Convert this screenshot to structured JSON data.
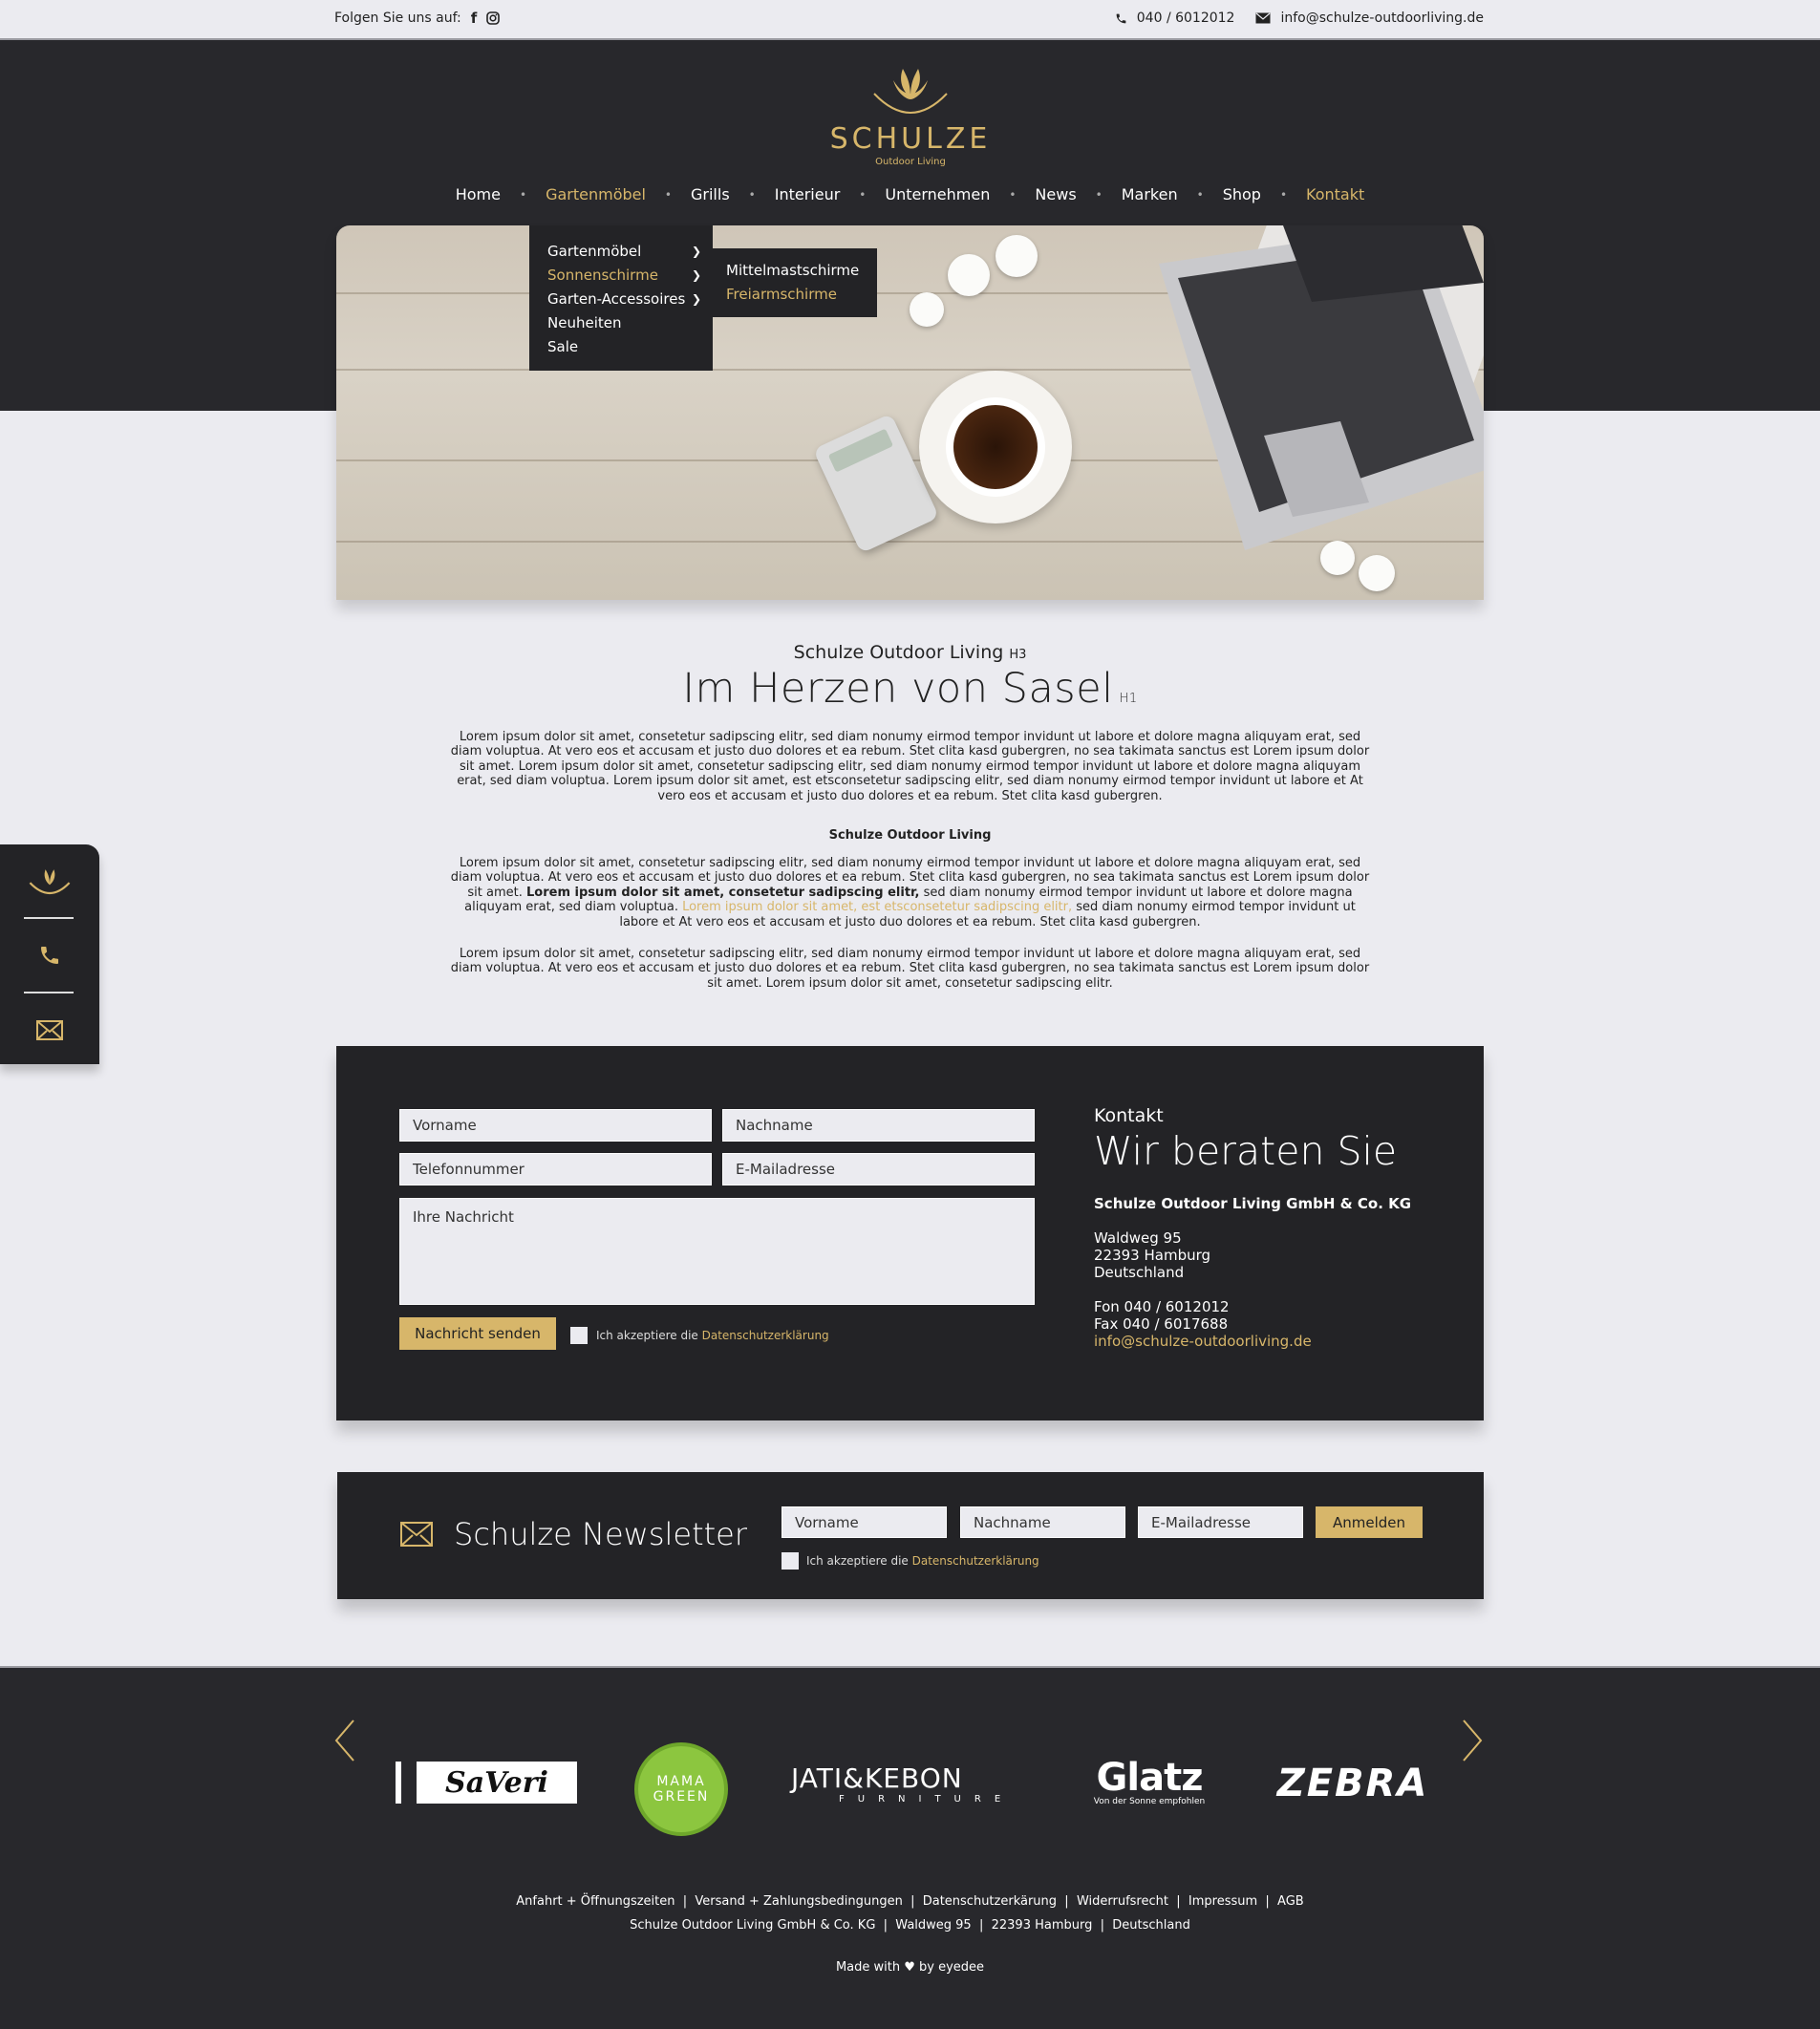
{
  "topbar": {
    "follow_label": "Folgen Sie uns auf:",
    "phone": "040 / 6012012",
    "email": "info@schulze-outdoorliving.de",
    "icons": [
      "facebook-icon",
      "instagram-icon",
      "phone-icon",
      "mail-icon"
    ]
  },
  "logo": {
    "brand": "SCHULZE",
    "sub": "Outdoor Living"
  },
  "nav": {
    "items": [
      {
        "label": "Home",
        "active": false
      },
      {
        "label": "Gartenmöbel",
        "active": true
      },
      {
        "label": "Grills",
        "active": false
      },
      {
        "label": "Interieur",
        "active": false
      },
      {
        "label": "Unternehmen",
        "active": false
      },
      {
        "label": "News",
        "active": false
      },
      {
        "label": "Marken",
        "active": false
      },
      {
        "label": "Shop",
        "active": false
      },
      {
        "label": "Kontakt",
        "active": true
      }
    ],
    "dropdown": [
      "Gartenmöbel",
      "Sonnenschirme",
      "Garten-Accessoires",
      "Neuheiten",
      "Sale"
    ],
    "subdropdown": [
      "Mittelmastschirme",
      "Freiarmschirme"
    ]
  },
  "intro": {
    "h3": "Schulze Outdoor Living",
    "h3_tag": "H3",
    "h1": "Im Herzen von Sasel",
    "h1_tag": "H1",
    "para1": "Lorem ipsum dolor sit amet, consetetur sadipscing elitr, sed diam nonumy eirmod tempor invidunt ut labore et dolore magna aliquyam erat, sed diam voluptua. At vero eos et accusam et justo duo dolores et ea rebum. Stet clita kasd gubergren, no sea takimata sanctus est Lorem ipsum dolor sit amet. Lorem ipsum dolor sit amet, consetetur sadipscing elitr, sed diam nonumy eirmod tempor invidunt ut labore et dolore magna aliquyam erat, sed diam voluptua. Lorem ipsum dolor sit amet, est etsconsetetur sadipscing elitr, sed diam nonumy eirmod tempor invidunt ut labore et At vero eos et accusam et justo duo dolores et ea rebum. Stet clita kasd gubergren.",
    "subhead": "Schulze Outdoor Living",
    "para2_a": "Lorem ipsum dolor sit amet, consetetur sadipscing elitr, sed diam nonumy eirmod tempor invidunt ut labore et dolore magna aliquyam erat, sed diam voluptua. At vero eos et accusam et justo duo dolores et ea rebum. Stet clita kasd gubergren, no sea takimata sanctus est Lorem ipsum dolor sit amet. ",
    "para2_bold": "Lorem ipsum dolor sit amet, consetetur sadipscing elitr,",
    "para2_b": " sed diam nonumy eirmod tempor invidunt ut labore et dolore magna aliquyam erat, sed diam voluptua. ",
    "para2_gold": "Lorem ipsum dolor sit amet, est etsconsetetur sadipscing elitr,",
    "para2_c": " sed diam nonumy eirmod tempor invidunt ut labore et At vero eos et accusam et justo duo dolores et ea rebum. Stet clita kasd gubergren.",
    "para3": "Lorem ipsum dolor sit amet, consetetur sadipscing elitr, sed diam nonumy eirmod tempor invidunt ut labore et dolore magna aliquyam erat, sed diam voluptua. At vero eos et accusam et justo duo dolores et ea rebum. Stet clita kasd gubergren, no sea takimata sanctus est Lorem ipsum dolor sit amet. Lorem ipsum dolor sit amet, consetetur sadipscing elitr."
  },
  "contact_form": {
    "vorname": "Vorname",
    "nachname": "Nachname",
    "telefon": "Telefonnummer",
    "email": "E-Mailadresse",
    "nachricht": "Ihre Nachricht",
    "submit": "Nachricht senden",
    "accept_prefix": "Ich akzeptiere die",
    "accept_link": "Datenschutzerklärung"
  },
  "contact_info": {
    "label": "Kontakt",
    "title": "Wir beraten Sie",
    "company": "Schulze Outdoor Living GmbH & Co. KG",
    "street": "Waldweg 95",
    "city": "22393 Hamburg",
    "country": "Deutschland",
    "fon": "Fon 040 / 6012012",
    "fax": "Fax 040 / 6017688",
    "email": "info@schulze-outdoorliving.de"
  },
  "newsletter": {
    "title": "Schulze Newsletter",
    "vorname": "Vorname",
    "nachname": "Nachname",
    "email": "E-Mailadresse",
    "submit": "Anmelden",
    "accept_prefix": "Ich akzeptiere die",
    "accept_link": "Datenschutzerklärung"
  },
  "brands": {
    "saveri": "SaVeri",
    "mama_green_1": "MAMA",
    "mama_green_2": "GREEN",
    "jati_1": "JATI&KEBON",
    "jati_2": "FURNITURE",
    "glatz_1": "Glatz",
    "glatz_2": "Von der Sonne empfohlen",
    "zebra": "ZEBRA"
  },
  "footer": {
    "links": "Anfahrt + Öffnungszeiten  |  Versand + Zahlungsbedingungen  |  Datenschutzerkärung  |  Widerrufsrecht  |  Impressum  |  AGB",
    "address": "Schulze Outdoor Living GmbH & Co. KG  |  Waldweg 95  |  22393 Hamburg  |  Deutschland",
    "made_prefix": "Made with",
    "made_suffix": "by eyedee"
  },
  "colors": {
    "gold": "#d7b66a",
    "dark": "#232326",
    "light": "#ebebf0"
  }
}
